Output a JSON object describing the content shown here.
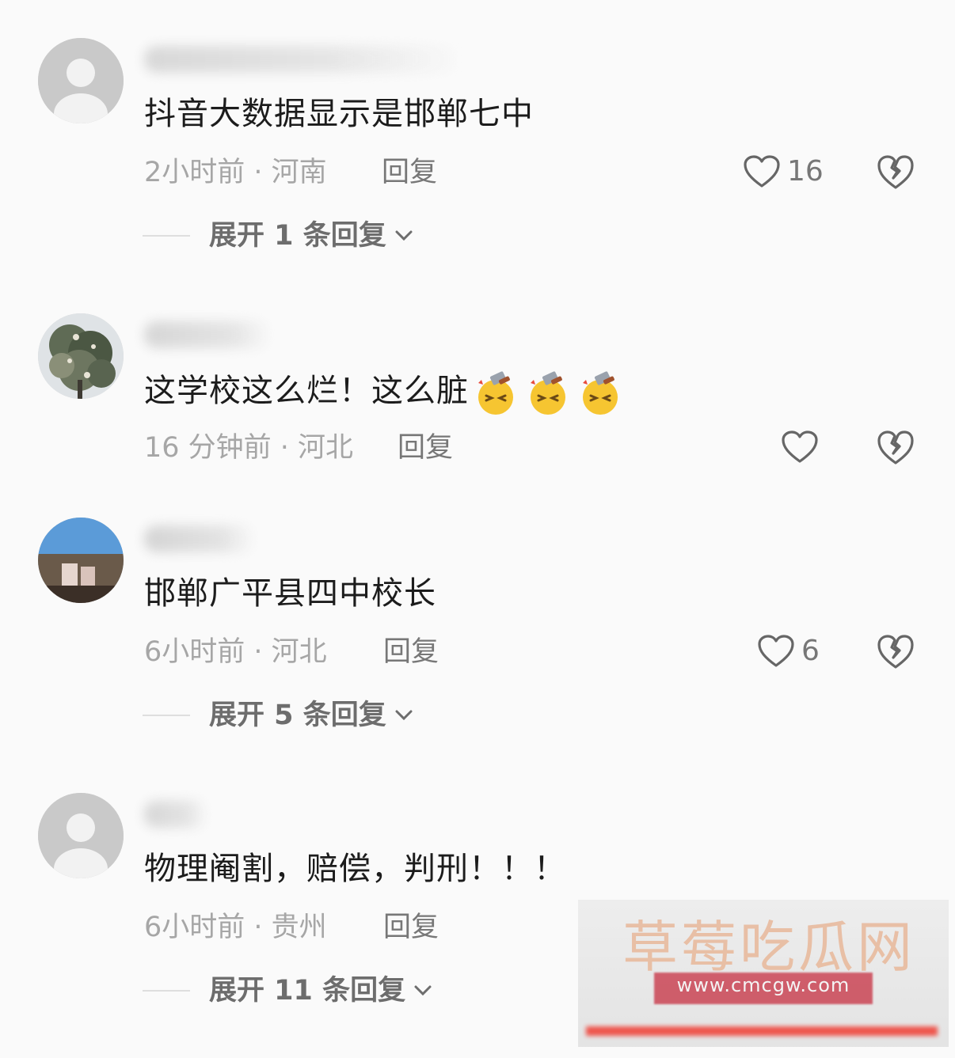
{
  "colors": {
    "background": "#fafafa",
    "text_primary": "#1c1c1c",
    "text_meta": "#a6a6a6",
    "text_reply": "#777777",
    "watermark_accent": "#c93b4c"
  },
  "comments": [
    {
      "text": "抖音大数据显示是邯郸七中",
      "meta": "2小时前 · 河南",
      "reply_label": "回复",
      "like_count": "16",
      "expand_label": "展开 1 条回复",
      "avatar": "default-person-icon"
    },
    {
      "text": "这学校这么烂！这么脏",
      "emojis": [
        "hammer-head-emoji",
        "hammer-head-emoji",
        "hammer-head-emoji"
      ],
      "meta": "16 分钟前 · 河北",
      "reply_label": "回复",
      "like_count": "",
      "avatar": "tree-photo"
    },
    {
      "text": "邯郸广平县四中校长",
      "meta": "6小时前 · 河北",
      "reply_label": "回复",
      "like_count": "6",
      "expand_label": "展开 5 条回复",
      "avatar": "outdoor-photo"
    },
    {
      "text": "物理阉割，赔偿，判刑！！！",
      "meta": "6小时前 · 贵州",
      "reply_label": "回复",
      "like_count": "",
      "expand_label": "展开 11 条回复",
      "avatar": "default-person-icon"
    }
  ],
  "watermark": {
    "title": "草莓吃瓜网",
    "url": "www.cmcgw.com"
  }
}
